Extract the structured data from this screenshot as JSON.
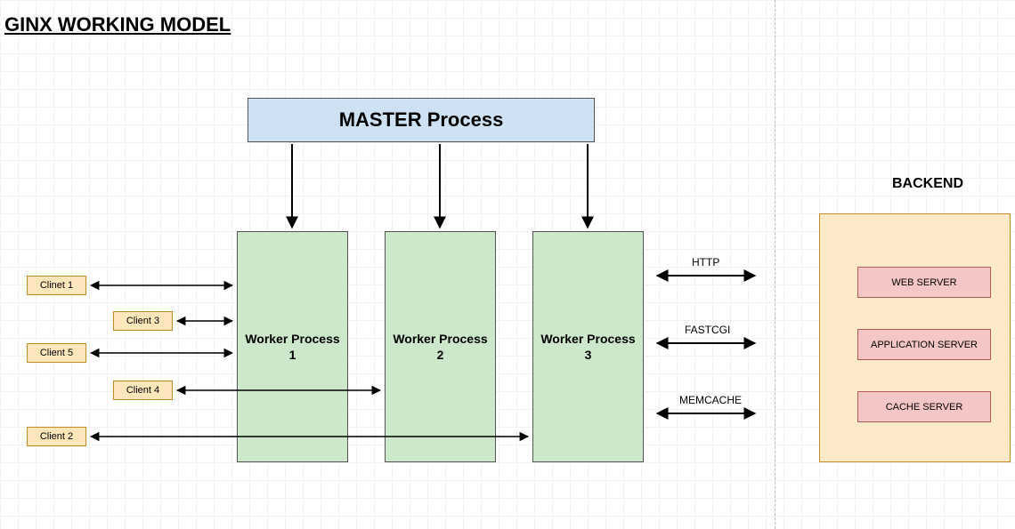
{
  "title": "GINX WORKING MODEL",
  "master": "MASTER Process",
  "workers": [
    "Worker Process\n1",
    "Worker Process\n2",
    "Worker Process\n3"
  ],
  "clients": [
    "Clinet 1",
    "Client 3",
    "Client 5",
    "Client 4",
    "Client 2"
  ],
  "protocols": [
    "HTTP",
    "FASTCGI",
    "MEMCACHE"
  ],
  "backend_label": "BACKEND",
  "servers": [
    "WEB SERVER",
    "APPLICATION SERVER",
    "CACHE SERVER"
  ]
}
